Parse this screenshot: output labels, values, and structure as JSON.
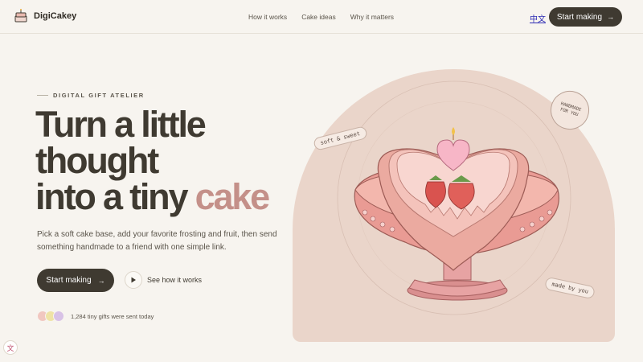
{
  "brand": {
    "name": "DigiCakey",
    "icon": "cake-icon"
  },
  "nav": {
    "items": [
      {
        "label": "How it works"
      },
      {
        "label": "Cake ideas"
      },
      {
        "label": "Why it matters"
      }
    ],
    "language": "中文",
    "cta": "Start making",
    "cta_arrow": "→"
  },
  "hero": {
    "eyebrow": "DIGITAL GIFT ATELIER",
    "headline": {
      "line1": "Turn a little",
      "line2": "thought",
      "line3_main": "into a tiny",
      "line3_accent": "cake"
    },
    "subtext": "Pick a soft cake base, add your favorite frosting and fruit, then send something handmade to a friend with one simple link.",
    "primary_cta": "Start making",
    "primary_cta_arrow": "→",
    "secondary_cta": "See how it works",
    "social_proof": "1,284 tiny gifts were sent today",
    "avatar_colors": [
      "#f1c7c0",
      "#efe3a6",
      "#d8c2e6"
    ]
  },
  "illustration": {
    "tag_left": "soft & sweet",
    "tag_right": "made by you",
    "stamp_line1": "HANDMADE",
    "stamp_line2": "FOR YOU"
  },
  "colors": {
    "accent": "#c49089",
    "dark": "#3f3a31",
    "background": "#f7f4ef",
    "arch": "#ead5ca"
  },
  "floating": {
    "translate_icon": "文"
  }
}
